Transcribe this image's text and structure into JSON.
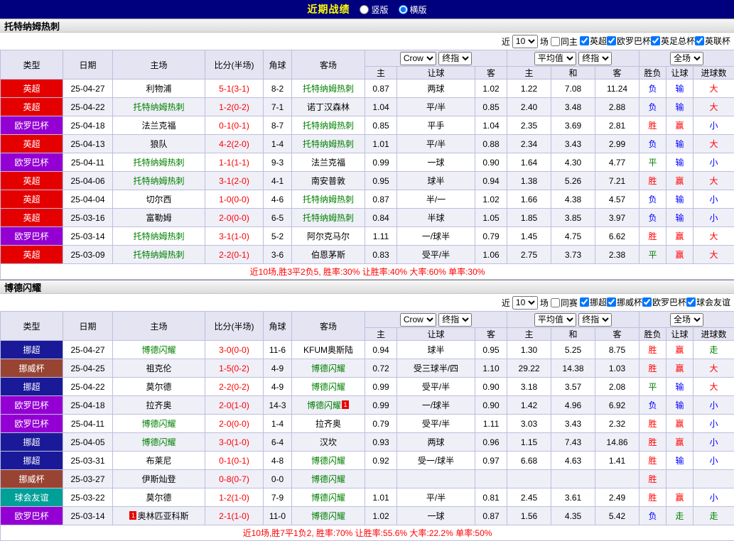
{
  "topbar": {
    "title": "近期战绩",
    "layout_options": [
      {
        "label": "竖版",
        "selected": false
      },
      {
        "label": "横版",
        "selected": true
      }
    ]
  },
  "filter_common": {
    "near_label": "近",
    "count_value": "10",
    "matches_label": "场"
  },
  "table_header": {
    "static_cols": [
      "类型",
      "日期",
      "主场",
      "比分(半场)",
      "角球",
      "客场"
    ],
    "odds_group": {
      "selects": [
        "Crow",
        "终指"
      ],
      "sub_cols": [
        "主",
        "让球",
        "客"
      ]
    },
    "avg_group": {
      "selects": [
        "平均值",
        "终指"
      ],
      "sub_cols": [
        "主",
        "和",
        "客"
      ]
    },
    "result_group": {
      "selects": [
        "全场"
      ],
      "sub_cols": [
        "胜负",
        "让球",
        "进球数"
      ]
    }
  },
  "colors": {
    "league_bg": {
      "英超": "#E50000",
      "欧罗巴杯": "#9400D3",
      "挪超": "#1A1A99",
      "挪威杯": "#994433",
      "球会友谊": "#00A099"
    },
    "result_text": {
      "胜": "#FF0000",
      "赢": "#FF0000",
      "大": "#FF0000",
      "负": "#0000FF",
      "输": "#0000FF",
      "小": "#0000FF",
      "平": "#008000",
      "走": "#008000"
    },
    "team_text": "#008000",
    "score_text": "#FF0000",
    "accent_navy": "#00007E"
  },
  "sections": [
    {
      "team": "托特纳姆热刺",
      "filter": {
        "same_label": "同主",
        "same_checked": false,
        "leagues": [
          {
            "label": "英超",
            "checked": true
          },
          {
            "label": "欧罗巴杯",
            "checked": true
          },
          {
            "label": "英足总杯",
            "checked": true
          },
          {
            "label": "英联杯",
            "checked": true
          }
        ]
      },
      "rows": [
        {
          "league": "英超",
          "date": "25-04-27",
          "home": "利物浦",
          "home_is_team": false,
          "home_card": null,
          "score": "5-1(3-1)",
          "corner": "8-2",
          "away": "托特纳姆热刺",
          "away_is_team": true,
          "away_card": null,
          "odds_home": "0.87",
          "handicap": "两球",
          "odds_away": "1.02",
          "avg_home": "1.22",
          "avg_draw": "7.08",
          "avg_away": "11.24",
          "res_wdl": "负",
          "res_handicap": "输",
          "res_goals": "大"
        },
        {
          "league": "英超",
          "date": "25-04-22",
          "home": "托特纳姆热刺",
          "home_is_team": true,
          "home_card": null,
          "score": "1-2(0-2)",
          "corner": "7-1",
          "away": "诺丁汉森林",
          "away_is_team": false,
          "away_card": null,
          "odds_home": "1.04",
          "handicap": "平/半",
          "odds_away": "0.85",
          "avg_home": "2.40",
          "avg_draw": "3.48",
          "avg_away": "2.88",
          "res_wdl": "负",
          "res_handicap": "输",
          "res_goals": "大"
        },
        {
          "league": "欧罗巴杯",
          "date": "25-04-18",
          "home": "法兰克福",
          "home_is_team": false,
          "home_card": null,
          "score": "0-1(0-1)",
          "corner": "8-7",
          "away": "托特纳姆热刺",
          "away_is_team": true,
          "away_card": null,
          "odds_home": "0.85",
          "handicap": "平手",
          "odds_away": "1.04",
          "avg_home": "2.35",
          "avg_draw": "3.69",
          "avg_away": "2.81",
          "res_wdl": "胜",
          "res_handicap": "赢",
          "res_goals": "小"
        },
        {
          "league": "英超",
          "date": "25-04-13",
          "home": "狼队",
          "home_is_team": false,
          "home_card": null,
          "score": "4-2(2-0)",
          "corner": "1-4",
          "away": "托特纳姆热刺",
          "away_is_team": true,
          "away_card": null,
          "odds_home": "1.01",
          "handicap": "平/半",
          "odds_away": "0.88",
          "avg_home": "2.34",
          "avg_draw": "3.43",
          "avg_away": "2.99",
          "res_wdl": "负",
          "res_handicap": "输",
          "res_goals": "大"
        },
        {
          "league": "欧罗巴杯",
          "date": "25-04-11",
          "home": "托特纳姆热刺",
          "home_is_team": true,
          "home_card": null,
          "score": "1-1(1-1)",
          "corner": "9-3",
          "away": "法兰克福",
          "away_is_team": false,
          "away_card": null,
          "odds_home": "0.99",
          "handicap": "一球",
          "odds_away": "0.90",
          "avg_home": "1.64",
          "avg_draw": "4.30",
          "avg_away": "4.77",
          "res_wdl": "平",
          "res_handicap": "输",
          "res_goals": "小"
        },
        {
          "league": "英超",
          "date": "25-04-06",
          "home": "托特纳姆热刺",
          "home_is_team": true,
          "home_card": null,
          "score": "3-1(2-0)",
          "corner": "4-1",
          "away": "南安普敦",
          "away_is_team": false,
          "away_card": null,
          "odds_home": "0.95",
          "handicap": "球半",
          "odds_away": "0.94",
          "avg_home": "1.38",
          "avg_draw": "5.26",
          "avg_away": "7.21",
          "res_wdl": "胜",
          "res_handicap": "赢",
          "res_goals": "大"
        },
        {
          "league": "英超",
          "date": "25-04-04",
          "home": "切尔西",
          "home_is_team": false,
          "home_card": null,
          "score": "1-0(0-0)",
          "corner": "4-6",
          "away": "托特纳姆热刺",
          "away_is_team": true,
          "away_card": null,
          "odds_home": "0.87",
          "handicap": "半/一",
          "odds_away": "1.02",
          "avg_home": "1.66",
          "avg_draw": "4.38",
          "avg_away": "4.57",
          "res_wdl": "负",
          "res_handicap": "输",
          "res_goals": "小"
        },
        {
          "league": "英超",
          "date": "25-03-16",
          "home": "富勒姆",
          "home_is_team": false,
          "home_card": null,
          "score": "2-0(0-0)",
          "corner": "6-5",
          "away": "托特纳姆热刺",
          "away_is_team": true,
          "away_card": null,
          "odds_home": "0.84",
          "handicap": "半球",
          "odds_away": "1.05",
          "avg_home": "1.85",
          "avg_draw": "3.85",
          "avg_away": "3.97",
          "res_wdl": "负",
          "res_handicap": "输",
          "res_goals": "小"
        },
        {
          "league": "欧罗巴杯",
          "date": "25-03-14",
          "home": "托特纳姆热刺",
          "home_is_team": true,
          "home_card": null,
          "score": "3-1(1-0)",
          "corner": "5-2",
          "away": "阿尔克马尔",
          "away_is_team": false,
          "away_card": null,
          "odds_home": "1.11",
          "handicap": "一/球半",
          "odds_away": "0.79",
          "avg_home": "1.45",
          "avg_draw": "4.75",
          "avg_away": "6.62",
          "res_wdl": "胜",
          "res_handicap": "赢",
          "res_goals": "大"
        },
        {
          "league": "英超",
          "date": "25-03-09",
          "home": "托特纳姆热刺",
          "home_is_team": true,
          "home_card": null,
          "score": "2-2(0-1)",
          "corner": "3-6",
          "away": "伯恩茅斯",
          "away_is_team": false,
          "away_card": null,
          "odds_home": "0.83",
          "handicap": "受平/半",
          "odds_away": "1.06",
          "avg_home": "2.75",
          "avg_draw": "3.73",
          "avg_away": "2.38",
          "res_wdl": "平",
          "res_handicap": "赢",
          "res_goals": "大"
        }
      ],
      "summary": "近10场,胜3平2负5, 胜率:30% 让胜率:40% 大率:60% 单率:30%"
    },
    {
      "team": "博德闪耀",
      "filter": {
        "same_label": "同赛",
        "same_checked": false,
        "leagues": [
          {
            "label": "挪超",
            "checked": true
          },
          {
            "label": "挪威杯",
            "checked": true
          },
          {
            "label": "欧罗巴杯",
            "checked": true
          },
          {
            "label": "球会友谊",
            "checked": true
          }
        ]
      },
      "rows": [
        {
          "league": "挪超",
          "date": "25-04-27",
          "home": "博德闪耀",
          "home_is_team": true,
          "home_card": null,
          "score": "3-0(0-0)",
          "corner": "11-6",
          "away": "KFUM奥斯陆",
          "away_is_team": false,
          "away_card": null,
          "odds_home": "0.94",
          "handicap": "球半",
          "odds_away": "0.95",
          "avg_home": "1.30",
          "avg_draw": "5.25",
          "avg_away": "8.75",
          "res_wdl": "胜",
          "res_handicap": "赢",
          "res_goals": "走"
        },
        {
          "league": "挪威杯",
          "date": "25-04-25",
          "home": "祖克伦",
          "home_is_team": false,
          "home_card": null,
          "score": "1-5(0-2)",
          "corner": "4-9",
          "away": "博德闪耀",
          "away_is_team": true,
          "away_card": null,
          "odds_home": "0.72",
          "handicap": "受三球半/四",
          "odds_away": "1.10",
          "avg_home": "29.22",
          "avg_draw": "14.38",
          "avg_away": "1.03",
          "res_wdl": "胜",
          "res_handicap": "赢",
          "res_goals": "大"
        },
        {
          "league": "挪超",
          "date": "25-04-22",
          "home": "莫尔德",
          "home_is_team": false,
          "home_card": null,
          "score": "2-2(0-2)",
          "corner": "4-9",
          "away": "博德闪耀",
          "away_is_team": true,
          "away_card": null,
          "odds_home": "0.99",
          "handicap": "受平/半",
          "odds_away": "0.90",
          "avg_home": "3.18",
          "avg_draw": "3.57",
          "avg_away": "2.08",
          "res_wdl": "平",
          "res_handicap": "输",
          "res_goals": "大"
        },
        {
          "league": "欧罗巴杯",
          "date": "25-04-18",
          "home": "拉齐奥",
          "home_is_team": false,
          "home_card": null,
          "score": "2-0(1-0)",
          "corner": "14-3",
          "away": "博德闪耀",
          "away_is_team": true,
          "away_card": "1",
          "odds_home": "0.99",
          "handicap": "一/球半",
          "odds_away": "0.90",
          "avg_home": "1.42",
          "avg_draw": "4.96",
          "avg_away": "6.92",
          "res_wdl": "负",
          "res_handicap": "输",
          "res_goals": "小"
        },
        {
          "league": "欧罗巴杯",
          "date": "25-04-11",
          "home": "博德闪耀",
          "home_is_team": true,
          "home_card": null,
          "score": "2-0(0-0)",
          "corner": "1-4",
          "away": "拉齐奥",
          "away_is_team": false,
          "away_card": null,
          "odds_home": "0.79",
          "handicap": "受平/半",
          "odds_away": "1.11",
          "avg_home": "3.03",
          "avg_draw": "3.43",
          "avg_away": "2.32",
          "res_wdl": "胜",
          "res_handicap": "赢",
          "res_goals": "小"
        },
        {
          "league": "挪超",
          "date": "25-04-05",
          "home": "博德闪耀",
          "home_is_team": true,
          "home_card": null,
          "score": "3-0(1-0)",
          "corner": "6-4",
          "away": "汉坎",
          "away_is_team": false,
          "away_card": null,
          "odds_home": "0.93",
          "handicap": "两球",
          "odds_away": "0.96",
          "avg_home": "1.15",
          "avg_draw": "7.43",
          "avg_away": "14.86",
          "res_wdl": "胜",
          "res_handicap": "赢",
          "res_goals": "小"
        },
        {
          "league": "挪超",
          "date": "25-03-31",
          "home": "布莱尼",
          "home_is_team": false,
          "home_card": null,
          "score": "0-1(0-1)",
          "corner": "4-8",
          "away": "博德闪耀",
          "away_is_team": true,
          "away_card": null,
          "odds_home": "0.92",
          "handicap": "受一/球半",
          "odds_away": "0.97",
          "avg_home": "6.68",
          "avg_draw": "4.63",
          "avg_away": "1.41",
          "res_wdl": "胜",
          "res_handicap": "输",
          "res_goals": "小"
        },
        {
          "league": "挪威杯",
          "date": "25-03-27",
          "home": "伊斯灿登",
          "home_is_team": false,
          "home_card": null,
          "score": "0-8(0-7)",
          "corner": "0-0",
          "away": "博德闪耀",
          "away_is_team": true,
          "away_card": null,
          "odds_home": "",
          "handicap": "",
          "odds_away": "",
          "avg_home": "",
          "avg_draw": "",
          "avg_away": "",
          "res_wdl": "胜",
          "res_handicap": "",
          "res_goals": ""
        },
        {
          "league": "球会友谊",
          "date": "25-03-22",
          "home": "莫尔德",
          "home_is_team": false,
          "home_card": null,
          "score": "1-2(1-0)",
          "corner": "7-9",
          "away": "博德闪耀",
          "away_is_team": true,
          "away_card": null,
          "odds_home": "1.01",
          "handicap": "平/半",
          "odds_away": "0.81",
          "avg_home": "2.45",
          "avg_draw": "3.61",
          "avg_away": "2.49",
          "res_wdl": "胜",
          "res_handicap": "赢",
          "res_goals": "小"
        },
        {
          "league": "欧罗巴杯",
          "date": "25-03-14",
          "home": "奥林匹亚科斯",
          "home_is_team": false,
          "home_card": "1",
          "score": "2-1(1-0)",
          "corner": "11-0",
          "away": "博德闪耀",
          "away_is_team": true,
          "away_card": null,
          "odds_home": "1.02",
          "handicap": "一球",
          "odds_away": "0.87",
          "avg_home": "1.56",
          "avg_draw": "4.35",
          "avg_away": "5.42",
          "res_wdl": "负",
          "res_handicap": "走",
          "res_goals": "走"
        }
      ],
      "summary": "近10场,胜7平1负2, 胜率:70% 让胜率:55.6% 大率:22.2% 单率:50%"
    }
  ]
}
